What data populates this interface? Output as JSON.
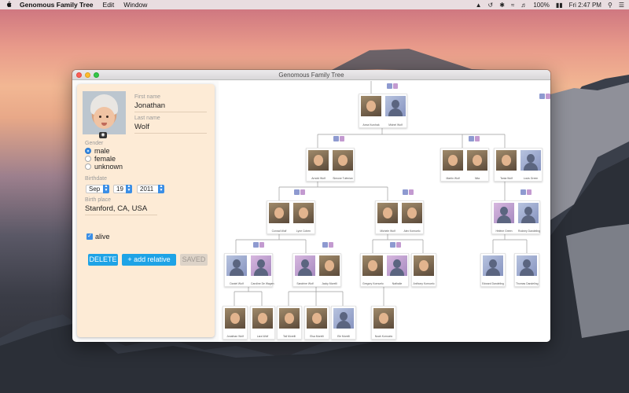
{
  "menubar": {
    "app_name": "Genomous Family Tree",
    "menus": [
      "Edit",
      "Window"
    ],
    "battery": "100%",
    "clock": "Fri 2:47 PM"
  },
  "window": {
    "title": "Genomous Family Tree"
  },
  "editor": {
    "first_name_label": "First name",
    "first_name": "Jonathan",
    "last_name_label": "Last name",
    "last_name": "Wolf",
    "gender_label": "Gender",
    "gender_options": [
      "male",
      "female",
      "unknown"
    ],
    "gender_selected": "male",
    "birthdate_label": "Birthdate",
    "birth_month": "Sep",
    "birth_day": "19",
    "birth_year": "2011",
    "birthplace_label": "Birth place",
    "birthplace": "Stanford, CA, USA",
    "alive_label": "alive",
    "alive": true,
    "delete_label": "DELETE",
    "add_relative_label": "+ add relative",
    "saved_label": "SAVED"
  },
  "tree": {
    "people": [
      {
        "name": "Anna Kurchak",
        "photo": "real"
      },
      {
        "name": "Michel Wolf",
        "photo": "silhouette"
      },
      {
        "name": "Arnold Wolf",
        "photo": "real"
      },
      {
        "name": "Simone Tufenian",
        "photo": "real"
      },
      {
        "name": "Martin Wolf",
        "photo": "real"
      },
      {
        "name": "Nita",
        "photo": "real"
      },
      {
        "name": "Tania Wolf",
        "photo": "real"
      },
      {
        "name": "Louis Green",
        "photo": "silhouette"
      },
      {
        "name": "Conrad Wolf",
        "photo": "real"
      },
      {
        "name": "Lyne Cohen",
        "photo": "real"
      },
      {
        "name": "Michele Wolf",
        "photo": "real"
      },
      {
        "name": "Alex Kornuelo",
        "photo": "real"
      },
      {
        "name": "Hélène Green",
        "photo": "silhouette-f"
      },
      {
        "name": "Rodney Dandeling",
        "photo": "silhouette"
      },
      {
        "name": "Daniel Wolf",
        "photo": "silhouette"
      },
      {
        "name": "Caroline De Wagen",
        "photo": "silhouette-f"
      },
      {
        "name": "Sandrine Wolf",
        "photo": "silhouette-f"
      },
      {
        "name": "Jacky Morelli",
        "photo": "real"
      },
      {
        "name": "Gregory Kornuelo",
        "photo": "real"
      },
      {
        "name": "Nathalie",
        "photo": "silhouette-f"
      },
      {
        "name": "Anthony Kornuelo",
        "photo": "real"
      },
      {
        "name": "Edward Dandeling",
        "photo": "silhouette"
      },
      {
        "name": "Thomas Dandeling",
        "photo": "silhouette"
      },
      {
        "name": "Jonathan Wolf",
        "photo": "real"
      },
      {
        "name": "Lara Wolf",
        "photo": "real"
      },
      {
        "name": "Tali Morelli",
        "photo": "real"
      },
      {
        "name": "Elsa Morelli",
        "photo": "real"
      },
      {
        "name": "Ele Morelli",
        "photo": "silhouette"
      },
      {
        "name": "Noah Kornuelo",
        "photo": "real"
      }
    ]
  },
  "icons": {
    "apple": "apple-logo-icon",
    "camera": "camera-icon"
  },
  "colors": {
    "accent": "#1ea3e6",
    "panel": "#fdebd6",
    "radio": "#3a8ee6"
  }
}
